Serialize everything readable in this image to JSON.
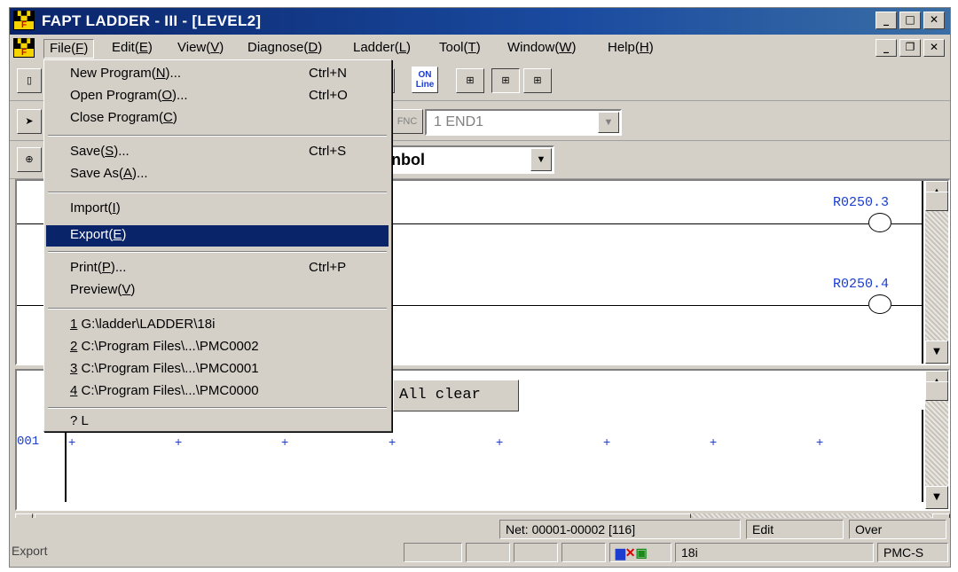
{
  "window": {
    "title": "FAPT LADDER - III - [LEVEL2]"
  },
  "menubar": {
    "items": [
      {
        "label": "File(",
        "key": "F",
        "tail": ")"
      },
      {
        "label": "Edit(",
        "key": "E",
        "tail": ")"
      },
      {
        "label": "View(",
        "key": "V",
        "tail": ")"
      },
      {
        "label": "Diagnose(",
        "key": "D",
        "tail": ")"
      },
      {
        "label": "Ladder(",
        "key": "L",
        "tail": ")"
      },
      {
        "label": "Tool(",
        "key": "T",
        "tail": ")"
      },
      {
        "label": "Window(",
        "key": "W",
        "tail": ")"
      },
      {
        "label": "Help(",
        "key": "H",
        "tail": ")"
      }
    ]
  },
  "file_menu": {
    "new": {
      "label": "New Program(",
      "key": "N",
      "tail": ")...",
      "shortcut": "Ctrl+N"
    },
    "open": {
      "label": "Open Program(",
      "key": "O",
      "tail": ")...",
      "shortcut": "Ctrl+O"
    },
    "close": {
      "label": "Close Program(",
      "key": "C",
      "tail": ")"
    },
    "save": {
      "label": "Save(",
      "key": "S",
      "tail": ")...",
      "shortcut": "Ctrl+S"
    },
    "saveas": {
      "label": "Save As(",
      "key": "A",
      "tail": ")..."
    },
    "import": {
      "label": "Import(",
      "key": "I",
      "tail": ")"
    },
    "export": {
      "label": "Export(",
      "key": "E",
      "tail": ")"
    },
    "print": {
      "label": "Print(",
      "key": "P",
      "tail": ")...",
      "shortcut": "Ctrl+P"
    },
    "preview": {
      "label": "Preview(",
      "key": "V",
      "tail": ")"
    },
    "recent": [
      {
        "num": "1",
        "path": " G:\\ladder\\LADDER\\18i"
      },
      {
        "num": "2",
        "path": " C:\\Program Files\\...\\PMC0002"
      },
      {
        "num": "3",
        "path": " C:\\Program Files\\...\\PMC0001"
      },
      {
        "num": "4",
        "path": " C:\\Program Files\\...\\PMC0000"
      }
    ],
    "last": "?  L"
  },
  "toolbar": {
    "online_line1": "ON",
    "online_line2": "Line",
    "fnc_label": "FNC",
    "function_combo_value": "1 END1",
    "symbol_combo_value": "nbol"
  },
  "ladder": {
    "coil1": "R0250.3",
    "coil2": "R0250.4",
    "all_clear": "All clear",
    "row_number": "001"
  },
  "statusbar": {
    "net": "Net: 00001-00002 [116]",
    "mode": "Edit",
    "over": "Over",
    "message": "Export",
    "model": "18i",
    "pmc": "PMC-S"
  },
  "colors": {
    "title_bar": "#0a246a",
    "highlight": "#0a246a",
    "ladder_blue": "#1a3ccf"
  }
}
